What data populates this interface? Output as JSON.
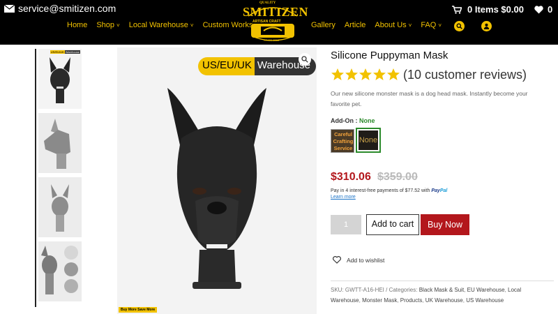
{
  "header": {
    "email": "service@smitizen.com",
    "nav_left": [
      {
        "label": "Home",
        "has_menu": false
      },
      {
        "label": "Shop",
        "has_menu": true
      },
      {
        "label": "Local Warehouse",
        "has_menu": true
      },
      {
        "label": "Custom Works",
        "has_menu": false
      }
    ],
    "nav_right": [
      {
        "label": "Gallery",
        "has_menu": false
      },
      {
        "label": "Article",
        "has_menu": false
      },
      {
        "label": "About Us",
        "has_menu": true
      },
      {
        "label": "FAQ",
        "has_menu": true
      }
    ],
    "logo": {
      "quality": "QUALITY",
      "brand": "SMITIZEN",
      "sub": "ARTISAN CRAFT",
      "since": "SINCE 2015"
    },
    "cart_label": "0 Items $0.00",
    "wishlist_count": "0"
  },
  "gallery": {
    "thumb_badge_left": "US/EU/UK",
    "thumb_badge_right": "Warehouse",
    "main_badge_left": "US/EU/UK",
    "main_badge_right": "Warehouse",
    "buy_more": "Buy More Save More"
  },
  "product": {
    "title": "Silicone Puppyman Mask",
    "rating": 5,
    "reviews": "(10 customer reviews)",
    "description": "Our new silicone monster mask is a dog head mask. Instantly become your favorite pet.",
    "addon_label": "Add-On : ",
    "addon_value": "None",
    "swatch1_text": "Careful Crafting Service",
    "swatch2_text": "None",
    "price": "$310.06",
    "old_price": "$359.00",
    "paypal_text": "Pay in 4 interest-free payments of $77.52 with",
    "paypal_brand_a": "Pay",
    "paypal_brand_b": "Pal",
    "learn_more": "Learn more",
    "quantity": "1",
    "add_to_cart": "Add to cart",
    "buy_now": "Buy Now",
    "add_to_wishlist": "Add to wishlist",
    "meta_sku_prefix": "SKU: GWTT-A16-HEI / Categories: ",
    "categories": [
      "Black Mask & Suit",
      "EU Warehouse",
      "Local Warehouse",
      "Monster Mask",
      "Products",
      "UK Warehouse",
      "US Warehouse"
    ]
  },
  "colors": {
    "accent": "#f2c200",
    "price": "#b3171c",
    "selected": "#2b8a2b"
  }
}
